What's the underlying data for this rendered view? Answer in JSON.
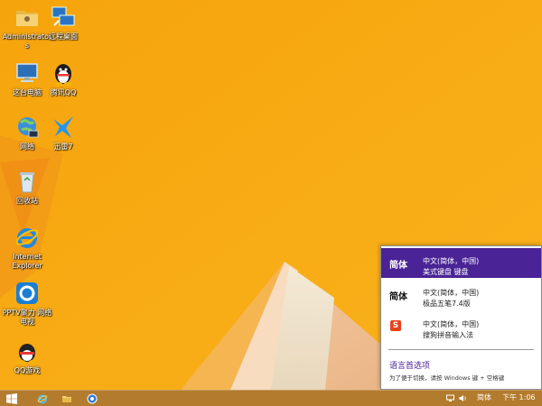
{
  "desktop": {
    "icons": [
      {
        "label": "Administrators",
        "icon": "folder-icon"
      },
      {
        "label": "远程桌面",
        "icon": "remote-desktop-icon"
      },
      {
        "label": "这台电脑",
        "icon": "computer-icon"
      },
      {
        "label": "腾讯QQ",
        "icon": "qq-icon"
      },
      {
        "label": "网络",
        "icon": "network-icon"
      },
      {
        "label": "迅雷7",
        "icon": "thunder-icon"
      },
      {
        "label": "回收站",
        "icon": "recycle-bin-icon"
      },
      {
        "label": "Internet Explorer",
        "icon": "internet-explorer-icon"
      },
      {
        "label": "PPTV聚力 网络电视",
        "icon": "pptv-icon"
      },
      {
        "label": "QQ游戏",
        "icon": "qq-game-icon"
      }
    ]
  },
  "language_flyout": {
    "items": [
      {
        "abbr": "简体",
        "language": "中文(简体，中国)",
        "layout": "美式键盘 键盘",
        "selected": true
      },
      {
        "abbr": "简体",
        "language": "中文(简体，中国)",
        "layout": "极品五笔7.4版",
        "selected": false
      },
      {
        "abbr": "S",
        "language": "中文(简体，中国)",
        "layout": "搜狗拼音输入法",
        "selected": false
      }
    ],
    "preferences_link": "语言首选项",
    "switch_hint": "为了便于切换，请按 Windows 键 + 空格键"
  },
  "taskbar": {
    "start_icon": "windows-logo-icon",
    "pinned": [
      "internet-explorer-icon",
      "file-explorer-icon",
      "network-globe-icon"
    ],
    "tray": {
      "language_indicator": "简体",
      "clock": "下午 1:06"
    }
  },
  "colors": {
    "wallpaper": "#f7a80f",
    "flyout_selected": "#4a2396",
    "taskbar": "#ac701c"
  }
}
